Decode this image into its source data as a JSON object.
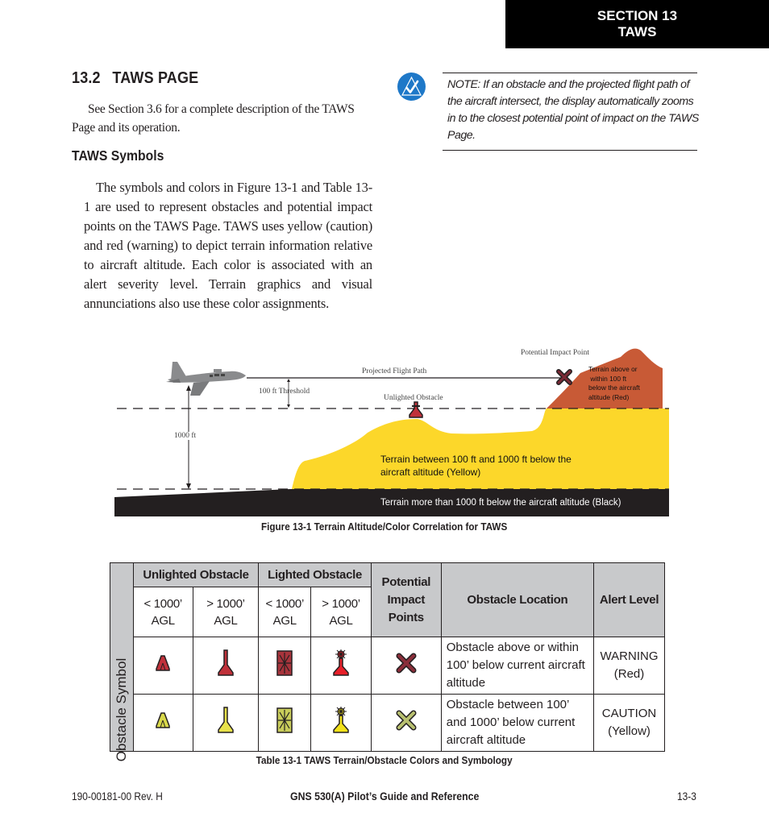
{
  "header": {
    "section_line1": "SECTION 13",
    "section_line2": "TAWS"
  },
  "heading": {
    "number": "13.2",
    "title": "TAWS PAGE"
  },
  "intro": "See Section 3.6 for a complete description of the TAWS Page and its operation.",
  "subheading": "TAWS Symbols",
  "body": "The symbols and colors in Figure 13-1 and Table 13-1 are used to represent obstacles and potential impact points on the TAWS Page.  TAWS uses yellow (caution)  and red (warning) to depict terrain information relative to aircraft altitude. Each color is associated with an alert severity level. Terrain graphics and visual annunciations also use these color assignments.",
  "note": {
    "icon": "check-note-icon",
    "text": "NOTE:  If an obstacle and the projected flight path of the aircraft intersect, the display automatically zooms in to the closest potential point of impact on the TAWS Page."
  },
  "figure": {
    "caption": "Figure 13-1  Terrain Altitude/Color Correlation for TAWS",
    "labels": {
      "projected_flight_path": "Projected Flight Path",
      "threshold_100": "100 ft Threshold",
      "unlighted_obstacle": "Unlighted Obstacle",
      "potential_impact_point": "Potential Impact Point",
      "ft_1000": "1000 ft",
      "red_terrain_l1": "Terrain above or",
      "red_terrain_l2": " within 100 ft",
      "red_terrain_l3": "below the aircraft",
      "red_terrain_l4": "altitude (Red)",
      "yellow_terrain_l1": "Terrain between 100 ft and 1000 ft below the",
      "yellow_terrain_l2": "aircraft altitude (Yellow)",
      "black_terrain": "Terrain more than 1000 ft below the aircraft altitude (Black)"
    },
    "colors": {
      "red_terrain": "#c85a36",
      "yellow_terrain": "#fcd72a",
      "black_terrain": "#231f20",
      "aircraft": "#8a8b8d"
    }
  },
  "table": {
    "caption": "Table 13-1  TAWS Terrain/Obstacle Colors and Symbology",
    "side_label": "Obstacle Symbol",
    "headers": {
      "unlighted": "Unlighted Obstacle",
      "lighted": "Lighted Obstacle",
      "impact": "Potential Impact Points",
      "location": "Obstacle Location",
      "alert": "Alert Level"
    },
    "subheaders": [
      {
        "line1": "< 1000’",
        "line2": "AGL"
      },
      {
        "line1": "> 1000’",
        "line2": "AGL"
      },
      {
        "line1": "< 1000’",
        "line2": "AGL"
      },
      {
        "line1": "> 1000’",
        "line2": "AGL"
      }
    ],
    "rows": [
      {
        "symbols": [
          "unlighted-low-obstacle-red-icon",
          "unlighted-high-obstacle-red-icon",
          "lighted-low-obstacle-red-icon",
          "lighted-high-obstacle-red-icon",
          "impact-point-red-icon"
        ],
        "location": "Obstacle above or within 100’ below current aircraft altitude",
        "alert_line1": "WARNING",
        "alert_line2": "(Red)",
        "color": "#c0313a"
      },
      {
        "symbols": [
          "unlighted-low-obstacle-yellow-icon",
          "unlighted-high-obstacle-yellow-icon",
          "lighted-low-obstacle-yellow-icon",
          "lighted-high-obstacle-yellow-icon",
          "impact-point-yellow-icon"
        ],
        "location": "Obstacle between 100’ and 1000’ below current aircraft altitude",
        "alert_line1": "CAUTION",
        "alert_line2": "(Yellow)",
        "color": "#e6e04a"
      }
    ]
  },
  "footer": {
    "doc_number": "190-00181-00  Rev. H",
    "title": "GNS 530(A) Pilot’s Guide and Reference",
    "page": "13-3"
  }
}
